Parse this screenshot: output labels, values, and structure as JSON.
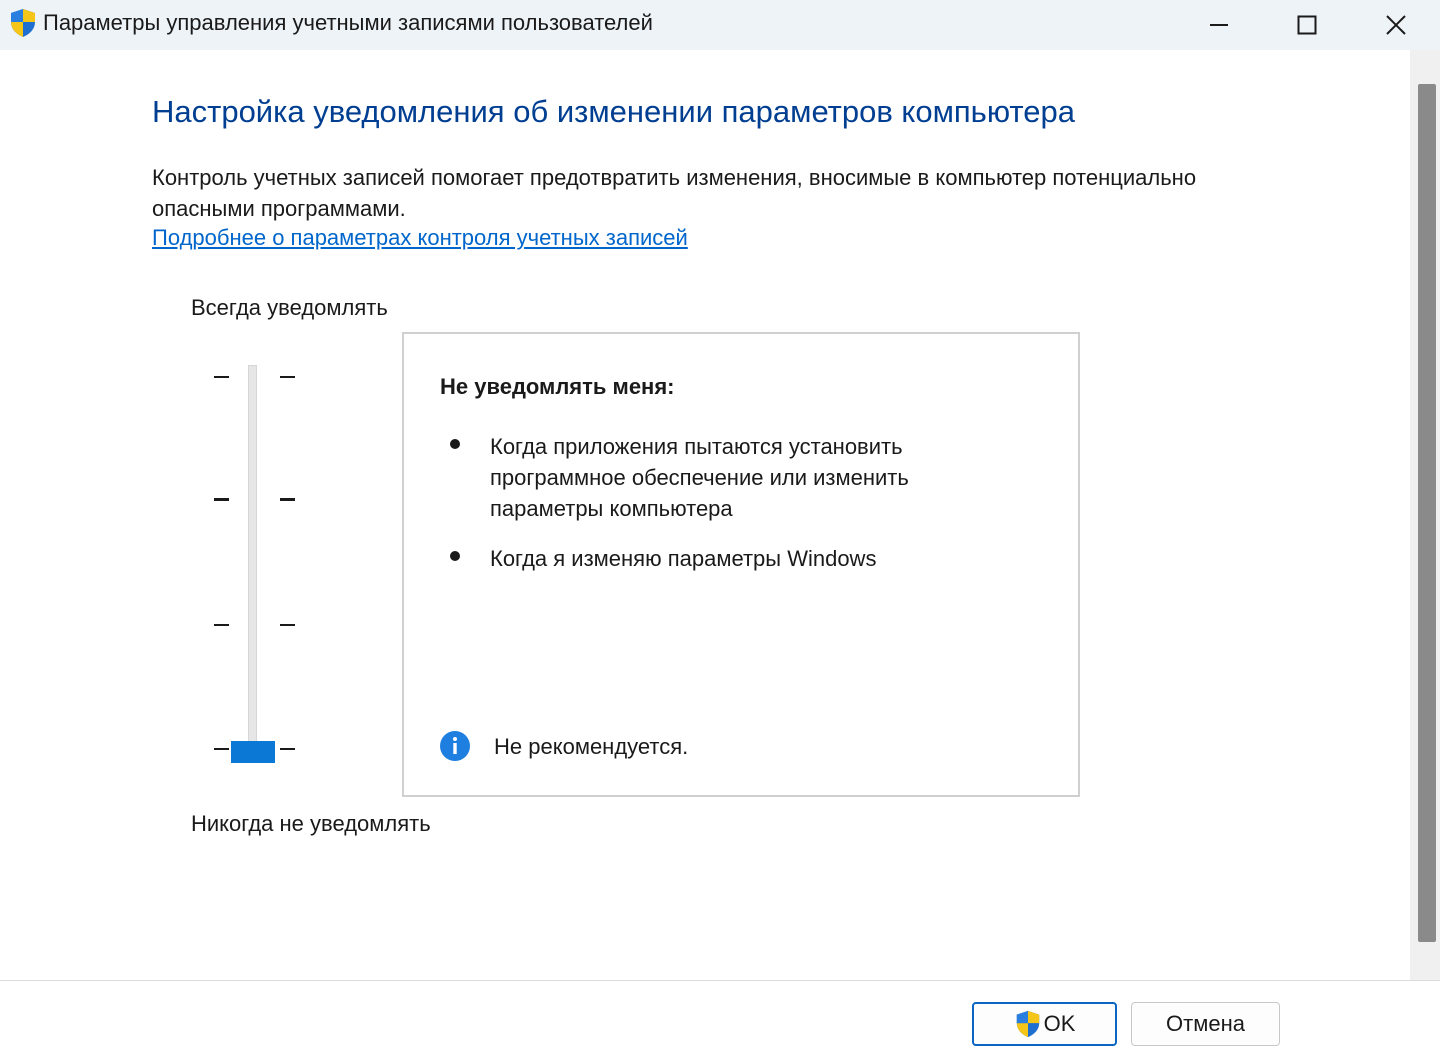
{
  "window": {
    "title": "Параметры управления учетными записями пользователей",
    "icon": "uac-shield-icon",
    "controls": [
      "minimize-icon",
      "maximize-icon",
      "close-icon"
    ]
  },
  "main": {
    "heading": "Настройка уведомления об изменении параметров компьютера",
    "description": "Контроль учетных записей помогает предотвратить изменения, вносимые в компьютер потенциально опасными программами.",
    "link": "Подробнее о параметрах контроля учетных записей"
  },
  "slider": {
    "top_label": "Всегда уведомлять",
    "bottom_label": "Никогда не уведомлять",
    "levels": 4,
    "selected_level": 1,
    "thumb_color": "#0a78d4"
  },
  "info_box": {
    "title": "Не уведомлять меня:",
    "bullets": [
      "Когда приложения пытаются установить программное обеспечение или изменить параметры компьютера",
      "Когда я изменяю параметры Windows"
    ],
    "note": "Не рекомендуется.",
    "note_icon": "info-icon"
  },
  "footer": {
    "ok_label": "OK",
    "cancel_label": "Отмена"
  },
  "colors": {
    "heading": "#003e92",
    "link": "#0066cc",
    "accent": "#0a78d4"
  }
}
